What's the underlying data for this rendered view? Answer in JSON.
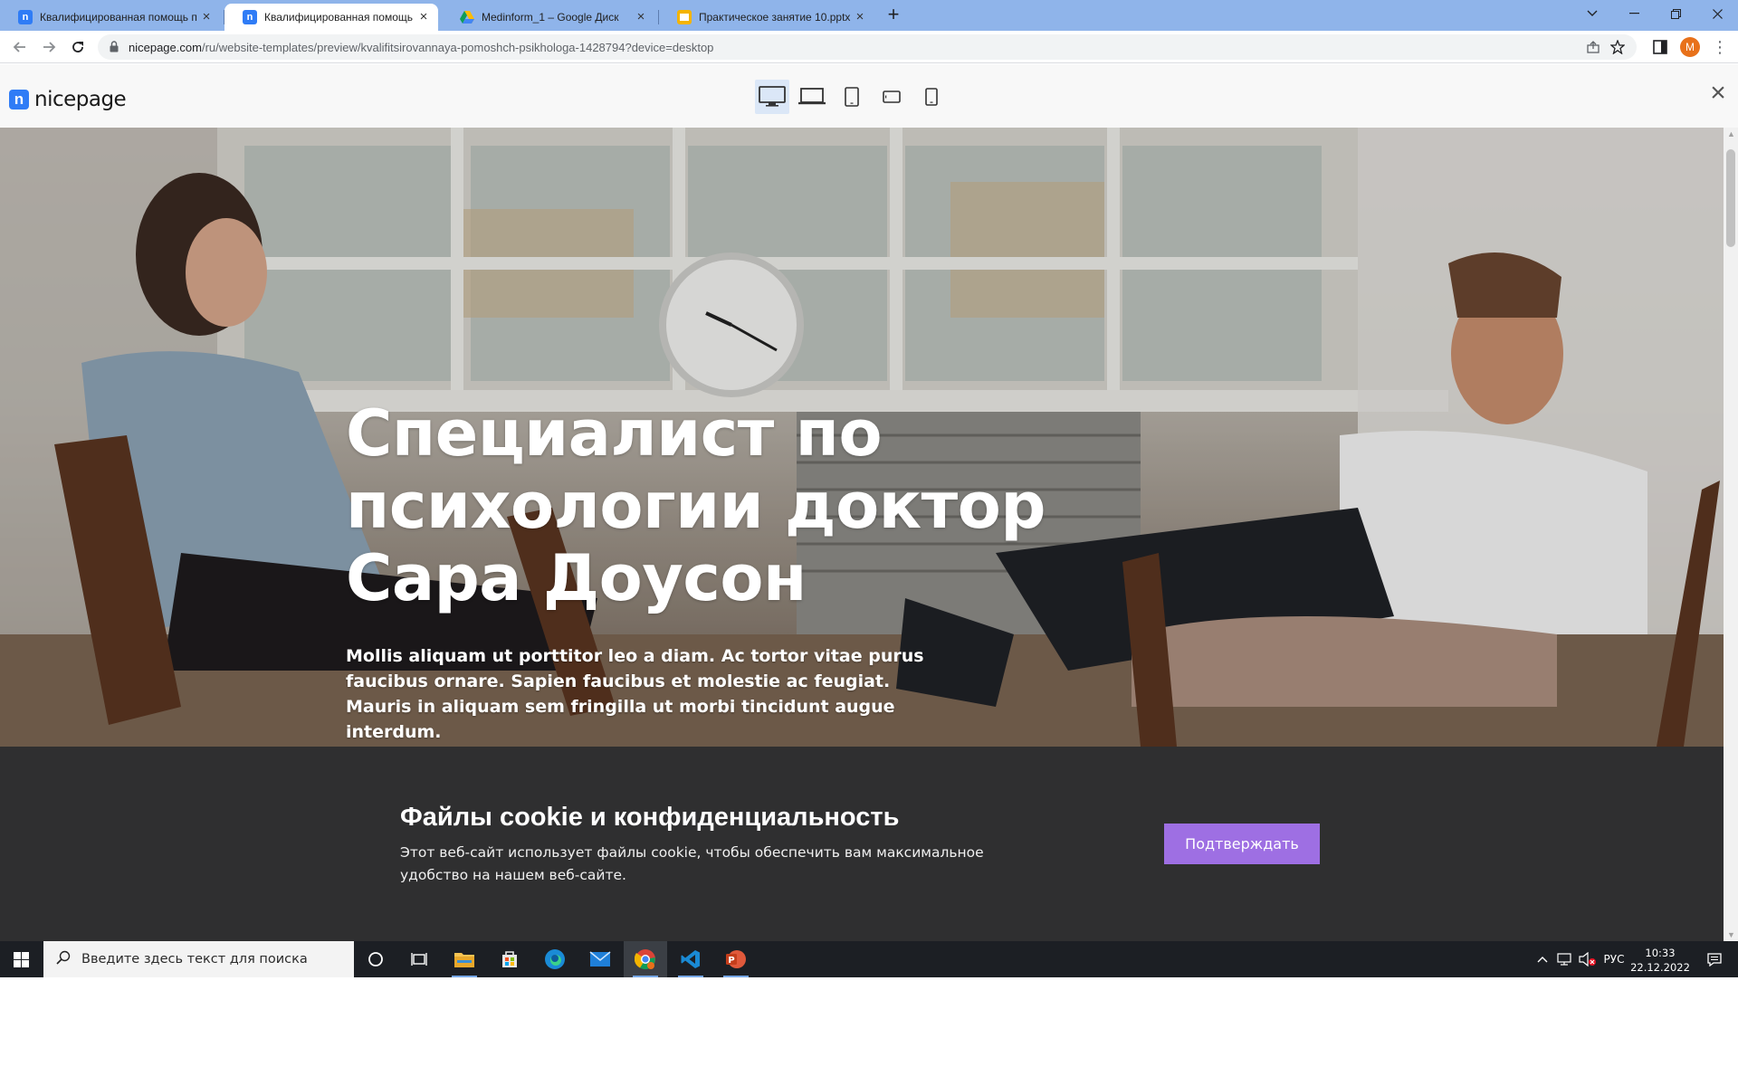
{
  "browser": {
    "tabs": [
      {
        "title": "Квалифицированная помощь п",
        "favicon": "nicepage-icon",
        "active": false
      },
      {
        "title": "Квалифицированная помощь п",
        "favicon": "nicepage-icon",
        "active": true
      },
      {
        "title": "Medinform_1 – Google Диск",
        "favicon": "google-drive-icon",
        "active": false
      },
      {
        "title": "Практическое занятие 10.pptx",
        "favicon": "google-slides-icon",
        "active": false
      }
    ],
    "url_domain": "nicepage.com",
    "url_path": "/ru/website-templates/preview/kvalifitsirovannaya-pomoshch-psikhologa-1428794?device=desktop",
    "profile_initial": "M",
    "profile_color": "#e8711a"
  },
  "nicepage": {
    "logo_text": "nicepage",
    "device_buttons": [
      "desktop-icon",
      "laptop-icon",
      "tablet-icon",
      "tablet-landscape-icon",
      "phone-icon"
    ],
    "active_device": "desktop-icon",
    "brand_color": "#2f7cf6"
  },
  "hero": {
    "title_line1": "Специалист по",
    "title_line2": "психологии доктор",
    "title_line3": "Сара Доусон",
    "description": "Mollis aliquam ut porttitor leo a diam. Ac tortor vitae purus faucibus ornare. Sapien faucibus et molestie ac feugiat. Mauris in aliquam sem fringilla ut morbi tincidunt augue interdum."
  },
  "cookie": {
    "title": "Файлы cookie и конфиденциальность",
    "text": "Этот веб-сайт использует файлы cookie, чтобы обеспечить вам максимальное удобство на нашем веб-сайте.",
    "button_label": "Подтверждать",
    "button_color": "#9e6fe3"
  },
  "taskbar": {
    "search_placeholder": "Введите здесь текст для поиска",
    "apps": [
      "file-explorer-icon",
      "microsoft-store-icon",
      "edge-icon",
      "mail-icon",
      "chrome-icon",
      "vscode-icon",
      "powerpoint-icon"
    ],
    "language": "РУС",
    "time": "10:33",
    "date": "22.12.2022"
  }
}
